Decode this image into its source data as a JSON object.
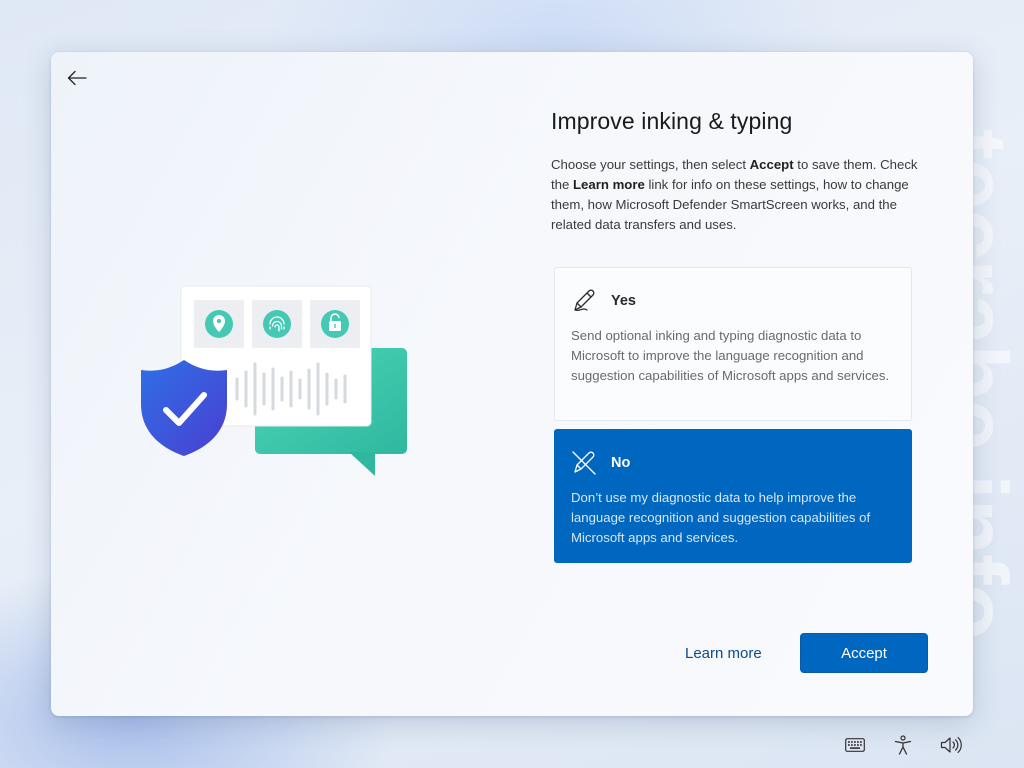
{
  "watermark": "tecrabe.info",
  "dialog": {
    "title": "Improve inking & typing",
    "description": {
      "part1": "Choose your settings, then select ",
      "accept_word": "Accept",
      "part2": " to save them. Check the ",
      "learn_more_word": "Learn more",
      "part3": " link for info on these settings, how to change them, how Microsoft Defender SmartScreen works, and the related data transfers and uses."
    },
    "options": [
      {
        "label": "Yes",
        "icon": "pen-icon",
        "text": "Send optional inking and typing diagnostic data to Microsoft to improve the language recognition and suggestion capabilities of Microsoft apps and services.",
        "selected": false
      },
      {
        "label": "No",
        "icon": "pen-off-icon",
        "text": "Don’t use my diagnostic data to help improve the language recognition and suggestion capabilities of Microsoft apps and services.",
        "selected": true
      }
    ],
    "learn_more_label": "Learn more",
    "accept_label": "Accept"
  },
  "tray": {
    "icons": [
      "keyboard-icon",
      "accessibility-icon",
      "volume-icon"
    ]
  },
  "colors": {
    "accent": "#0067c0",
    "shield": "#3b4fd8",
    "bubble": "#3ec9ad",
    "tile_icon": "#40c8b6"
  }
}
